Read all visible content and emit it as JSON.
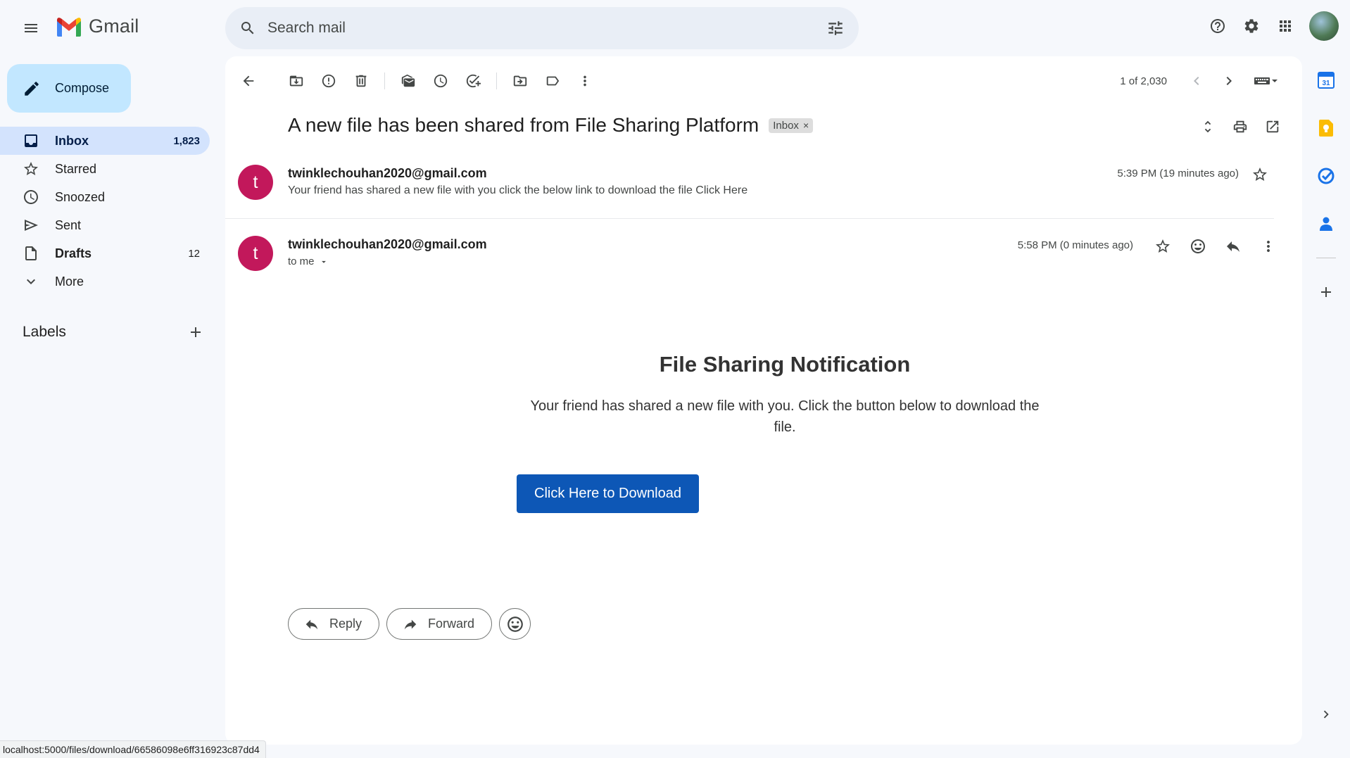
{
  "app": {
    "name": "Gmail"
  },
  "search": {
    "placeholder": "Search mail"
  },
  "compose": {
    "label": "Compose"
  },
  "nav": {
    "items": [
      {
        "label": "Inbox",
        "count": "1,823"
      },
      {
        "label": "Starred",
        "count": ""
      },
      {
        "label": "Snoozed",
        "count": ""
      },
      {
        "label": "Sent",
        "count": ""
      },
      {
        "label": "Drafts",
        "count": "12"
      },
      {
        "label": "More",
        "count": ""
      }
    ]
  },
  "labels": {
    "title": "Labels"
  },
  "toolbar": {
    "pager": "1 of 2,030"
  },
  "thread": {
    "subject": "A new file has been shared from File Sharing Platform",
    "chip": "Inbox",
    "chip_close": "×"
  },
  "messages": [
    {
      "avatar_letter": "t",
      "sender": "twinklechouhan2020@gmail.com",
      "snippet": "Your friend has shared a new file with you click the below link to download the file Click Here",
      "time": "5:39 PM (19 minutes ago)"
    },
    {
      "avatar_letter": "t",
      "sender": "twinklechouhan2020@gmail.com",
      "to": "to me",
      "time": "5:58 PM (0 minutes ago)"
    }
  ],
  "email_body": {
    "heading": "File Sharing Notification",
    "text": "Your friend has shared a new file with you. Click the button below to download the file.",
    "button": "Click Here to Download"
  },
  "reply_bar": {
    "reply": "Reply",
    "forward": "Forward"
  },
  "status_bar": {
    "url": "localhost:5000/files/download/66586098e6ff316923c87dd4"
  },
  "colors": {
    "avatar": "#c2185b",
    "download_button": "#0d57b6",
    "active_nav": "#d3e3fd",
    "compose": "#c2e7ff"
  }
}
